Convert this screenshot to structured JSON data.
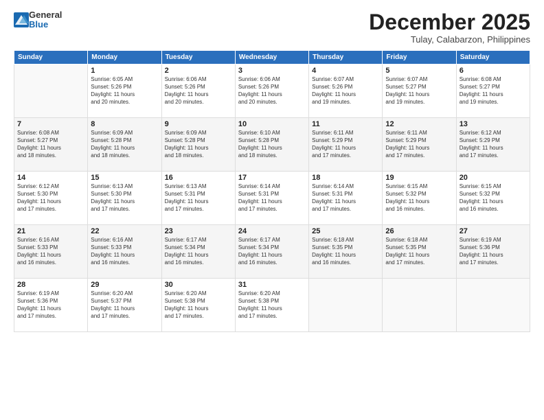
{
  "logo": {
    "general": "General",
    "blue": "Blue"
  },
  "header": {
    "month": "December 2025",
    "location": "Tulay, Calabarzon, Philippines"
  },
  "weekdays": [
    "Sunday",
    "Monday",
    "Tuesday",
    "Wednesday",
    "Thursday",
    "Friday",
    "Saturday"
  ],
  "weeks": [
    [
      {
        "day": "",
        "info": ""
      },
      {
        "day": "1",
        "info": "Sunrise: 6:05 AM\nSunset: 5:26 PM\nDaylight: 11 hours\nand 20 minutes."
      },
      {
        "day": "2",
        "info": "Sunrise: 6:06 AM\nSunset: 5:26 PM\nDaylight: 11 hours\nand 20 minutes."
      },
      {
        "day": "3",
        "info": "Sunrise: 6:06 AM\nSunset: 5:26 PM\nDaylight: 11 hours\nand 20 minutes."
      },
      {
        "day": "4",
        "info": "Sunrise: 6:07 AM\nSunset: 5:26 PM\nDaylight: 11 hours\nand 19 minutes."
      },
      {
        "day": "5",
        "info": "Sunrise: 6:07 AM\nSunset: 5:27 PM\nDaylight: 11 hours\nand 19 minutes."
      },
      {
        "day": "6",
        "info": "Sunrise: 6:08 AM\nSunset: 5:27 PM\nDaylight: 11 hours\nand 19 minutes."
      }
    ],
    [
      {
        "day": "7",
        "info": "Sunrise: 6:08 AM\nSunset: 5:27 PM\nDaylight: 11 hours\nand 18 minutes."
      },
      {
        "day": "8",
        "info": "Sunrise: 6:09 AM\nSunset: 5:28 PM\nDaylight: 11 hours\nand 18 minutes."
      },
      {
        "day": "9",
        "info": "Sunrise: 6:09 AM\nSunset: 5:28 PM\nDaylight: 11 hours\nand 18 minutes."
      },
      {
        "day": "10",
        "info": "Sunrise: 6:10 AM\nSunset: 5:28 PM\nDaylight: 11 hours\nand 18 minutes."
      },
      {
        "day": "11",
        "info": "Sunrise: 6:11 AM\nSunset: 5:29 PM\nDaylight: 11 hours\nand 17 minutes."
      },
      {
        "day": "12",
        "info": "Sunrise: 6:11 AM\nSunset: 5:29 PM\nDaylight: 11 hours\nand 17 minutes."
      },
      {
        "day": "13",
        "info": "Sunrise: 6:12 AM\nSunset: 5:29 PM\nDaylight: 11 hours\nand 17 minutes."
      }
    ],
    [
      {
        "day": "14",
        "info": "Sunrise: 6:12 AM\nSunset: 5:30 PM\nDaylight: 11 hours\nand 17 minutes."
      },
      {
        "day": "15",
        "info": "Sunrise: 6:13 AM\nSunset: 5:30 PM\nDaylight: 11 hours\nand 17 minutes."
      },
      {
        "day": "16",
        "info": "Sunrise: 6:13 AM\nSunset: 5:31 PM\nDaylight: 11 hours\nand 17 minutes."
      },
      {
        "day": "17",
        "info": "Sunrise: 6:14 AM\nSunset: 5:31 PM\nDaylight: 11 hours\nand 17 minutes."
      },
      {
        "day": "18",
        "info": "Sunrise: 6:14 AM\nSunset: 5:31 PM\nDaylight: 11 hours\nand 17 minutes."
      },
      {
        "day": "19",
        "info": "Sunrise: 6:15 AM\nSunset: 5:32 PM\nDaylight: 11 hours\nand 16 minutes."
      },
      {
        "day": "20",
        "info": "Sunrise: 6:15 AM\nSunset: 5:32 PM\nDaylight: 11 hours\nand 16 minutes."
      }
    ],
    [
      {
        "day": "21",
        "info": "Sunrise: 6:16 AM\nSunset: 5:33 PM\nDaylight: 11 hours\nand 16 minutes."
      },
      {
        "day": "22",
        "info": "Sunrise: 6:16 AM\nSunset: 5:33 PM\nDaylight: 11 hours\nand 16 minutes."
      },
      {
        "day": "23",
        "info": "Sunrise: 6:17 AM\nSunset: 5:34 PM\nDaylight: 11 hours\nand 16 minutes."
      },
      {
        "day": "24",
        "info": "Sunrise: 6:17 AM\nSunset: 5:34 PM\nDaylight: 11 hours\nand 16 minutes."
      },
      {
        "day": "25",
        "info": "Sunrise: 6:18 AM\nSunset: 5:35 PM\nDaylight: 11 hours\nand 16 minutes."
      },
      {
        "day": "26",
        "info": "Sunrise: 6:18 AM\nSunset: 5:35 PM\nDaylight: 11 hours\nand 17 minutes."
      },
      {
        "day": "27",
        "info": "Sunrise: 6:19 AM\nSunset: 5:36 PM\nDaylight: 11 hours\nand 17 minutes."
      }
    ],
    [
      {
        "day": "28",
        "info": "Sunrise: 6:19 AM\nSunset: 5:36 PM\nDaylight: 11 hours\nand 17 minutes."
      },
      {
        "day": "29",
        "info": "Sunrise: 6:20 AM\nSunset: 5:37 PM\nDaylight: 11 hours\nand 17 minutes."
      },
      {
        "day": "30",
        "info": "Sunrise: 6:20 AM\nSunset: 5:38 PM\nDaylight: 11 hours\nand 17 minutes."
      },
      {
        "day": "31",
        "info": "Sunrise: 6:20 AM\nSunset: 5:38 PM\nDaylight: 11 hours\nand 17 minutes."
      },
      {
        "day": "",
        "info": ""
      },
      {
        "day": "",
        "info": ""
      },
      {
        "day": "",
        "info": ""
      }
    ]
  ]
}
